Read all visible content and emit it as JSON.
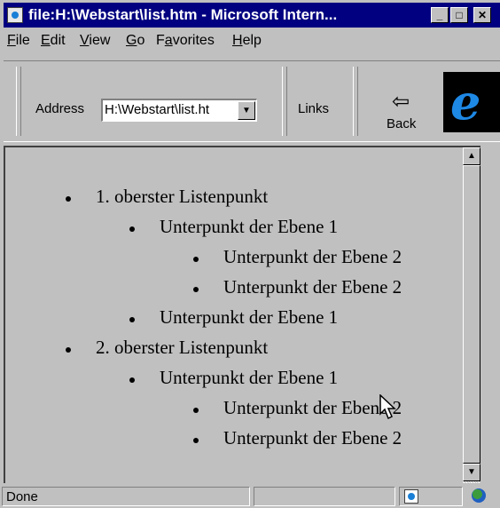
{
  "window": {
    "title": "file:H:\\Webstart\\list.htm - Microsoft Intern...",
    "buttons": {
      "minimize": "_",
      "maximize": "□",
      "close": "✕"
    }
  },
  "menu": {
    "items": [
      {
        "accel": "F",
        "rest": "ile"
      },
      {
        "accel": "E",
        "rest": "dit"
      },
      {
        "accel": "V",
        "rest": "iew"
      },
      {
        "accel": "G",
        "rest": "o"
      },
      {
        "pre": "F",
        "accel": "a",
        "rest": "vorites"
      },
      {
        "accel": "H",
        "rest": "elp"
      }
    ]
  },
  "toolbar": {
    "address_label": "Address",
    "address_value": "H:\\Webstart\\list.ht",
    "links_label": "Links",
    "back_label": "Back",
    "back_icon": "back-arrow-icon",
    "logo_icon": "internet-explorer-logo"
  },
  "list": {
    "item1": "1. oberster Listenpunkt",
    "item1_sub1": "Unterpunkt der Ebene 1",
    "item1_sub1_a": "Unterpunkt der Ebene 2",
    "item1_sub1_b": "Unterpunkt der Ebene 2",
    "item1_sub2": "Unterpunkt der Ebene 1",
    "item2": "2. oberster Listenpunkt",
    "item2_sub1": "Unterpunkt der Ebene 1",
    "item2_sub1_a": "Unterpunkt der Ebene 2",
    "item2_sub1_b": "Unterpunkt der Ebene 2"
  },
  "status": {
    "text": "Done",
    "zone_icon": "my-computer-zone-icon",
    "globe_icon": "internet-globe-icon"
  },
  "colors": {
    "title_bar": "#000080",
    "chrome": "#c0c0c0"
  }
}
